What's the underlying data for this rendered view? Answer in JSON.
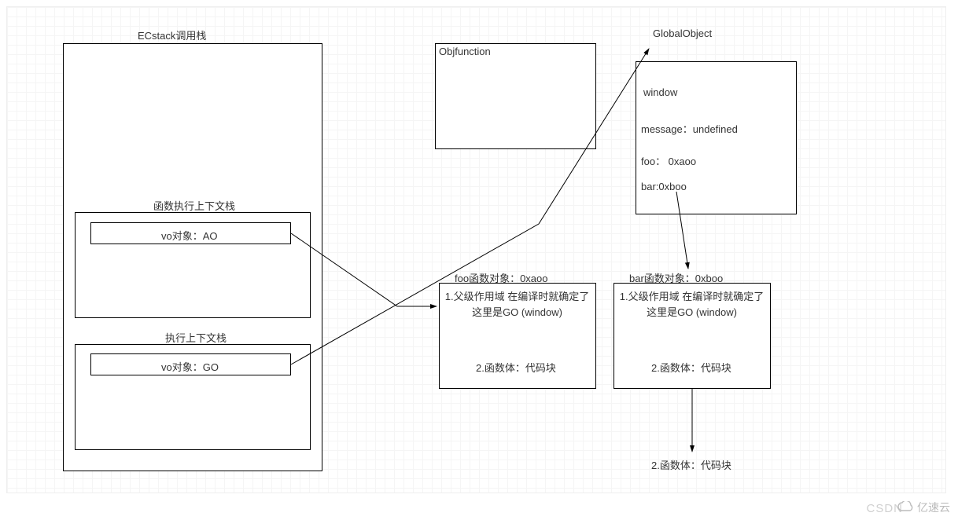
{
  "ecstack": {
    "title": "ECstack调用栈",
    "funcCtx": {
      "title": "函数执行上下文栈",
      "vo": "vo对象：AO"
    },
    "execCtx": {
      "title": "执行上下文栈",
      "vo": "vo对象：GO"
    }
  },
  "objfunction": {
    "title": "Objfunction"
  },
  "globalObject": {
    "title": "GlobalObject",
    "line1": "window",
    "line2": "message：undefined",
    "line3": "foo： 0xaoo",
    "line4": "bar:0xboo"
  },
  "fooBox": {
    "title": "foo函数对象：0xaoo",
    "line1": "1.父级作用域 在编译时就确定了 这里是GO  (window)",
    "line2": "2.函数体：代码块"
  },
  "barBox": {
    "title": "bar函数对象：0xboo",
    "line1": "1.父级作用域 在编译时就确定了 这里是GO  (window)",
    "line2": "2.函数体：代码块"
  },
  "floating": "2.函数体：代码块",
  "watermark": "CSDN",
  "brand": "亿速云"
}
